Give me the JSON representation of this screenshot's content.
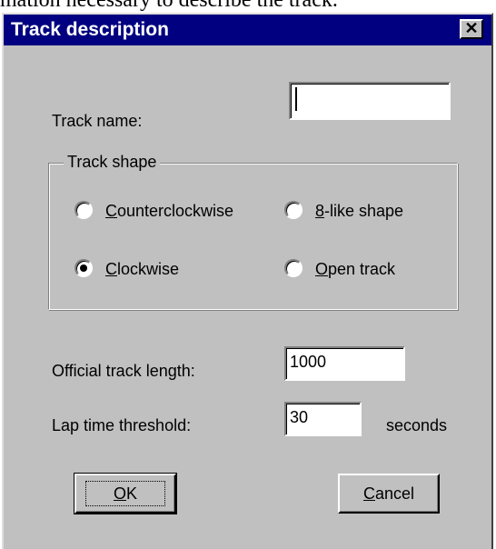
{
  "context": {
    "text": "mation necessary to describe the track."
  },
  "dialog": {
    "title": "Track description",
    "close_glyph": "✕"
  },
  "track_name": {
    "label": "Track name:",
    "value": ""
  },
  "track_shape": {
    "legend": "Track shape",
    "options": [
      {
        "key": "C",
        "rest": "ounterclockwise",
        "checked": false
      },
      {
        "key": "8",
        "rest": "-like shape",
        "checked": false
      },
      {
        "key": "C",
        "rest": "lockwise",
        "checked": true
      },
      {
        "key": "O",
        "rest": "pen track",
        "checked": false
      }
    ]
  },
  "official_length": {
    "label": "Official track length:",
    "value": "1000"
  },
  "lap_threshold": {
    "label": "Lap time threshold:",
    "value": "30",
    "unit": "seconds"
  },
  "buttons": {
    "ok_key": "O",
    "ok_rest": "K",
    "cancel_key": "C",
    "cancel_rest": "ancel"
  }
}
